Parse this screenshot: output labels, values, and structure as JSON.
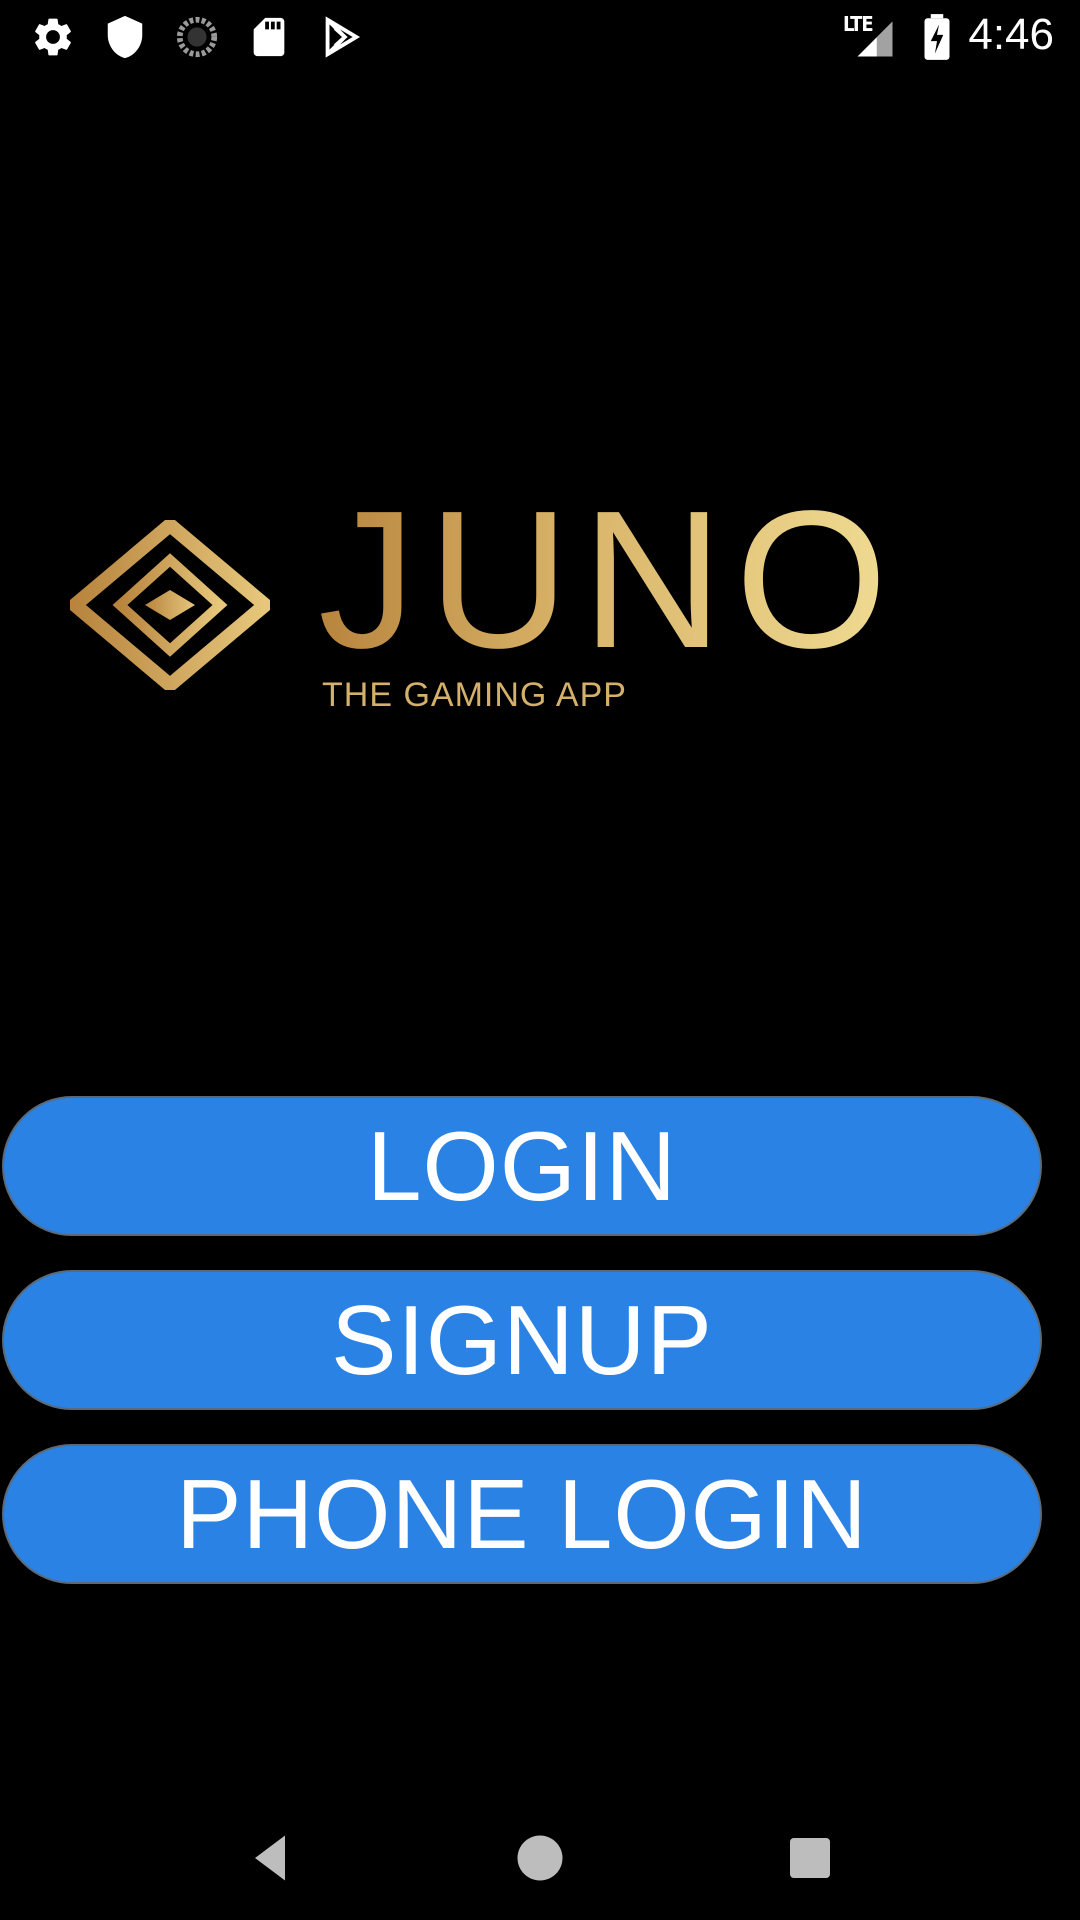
{
  "status_bar": {
    "network_label": "LTE",
    "time": "4:46",
    "icons": [
      "settings-icon",
      "shield-icon",
      "sync-icon",
      "sd-card-icon",
      "play-store-icon",
      "signal-icon",
      "battery-charging-icon"
    ]
  },
  "logo": {
    "wordmark": "JUNO",
    "tagline": "THE GAMING APP",
    "gold_start": "#b8843e",
    "gold_end": "#f0dc93"
  },
  "buttons": {
    "login_label": "LOGIN",
    "signup_label": "SIGNUP",
    "phone_login_label": "PHONE LOGIN",
    "color": "#2a82e4"
  },
  "nav": {
    "icons": [
      "back-icon",
      "home-icon",
      "recents-icon"
    ]
  }
}
